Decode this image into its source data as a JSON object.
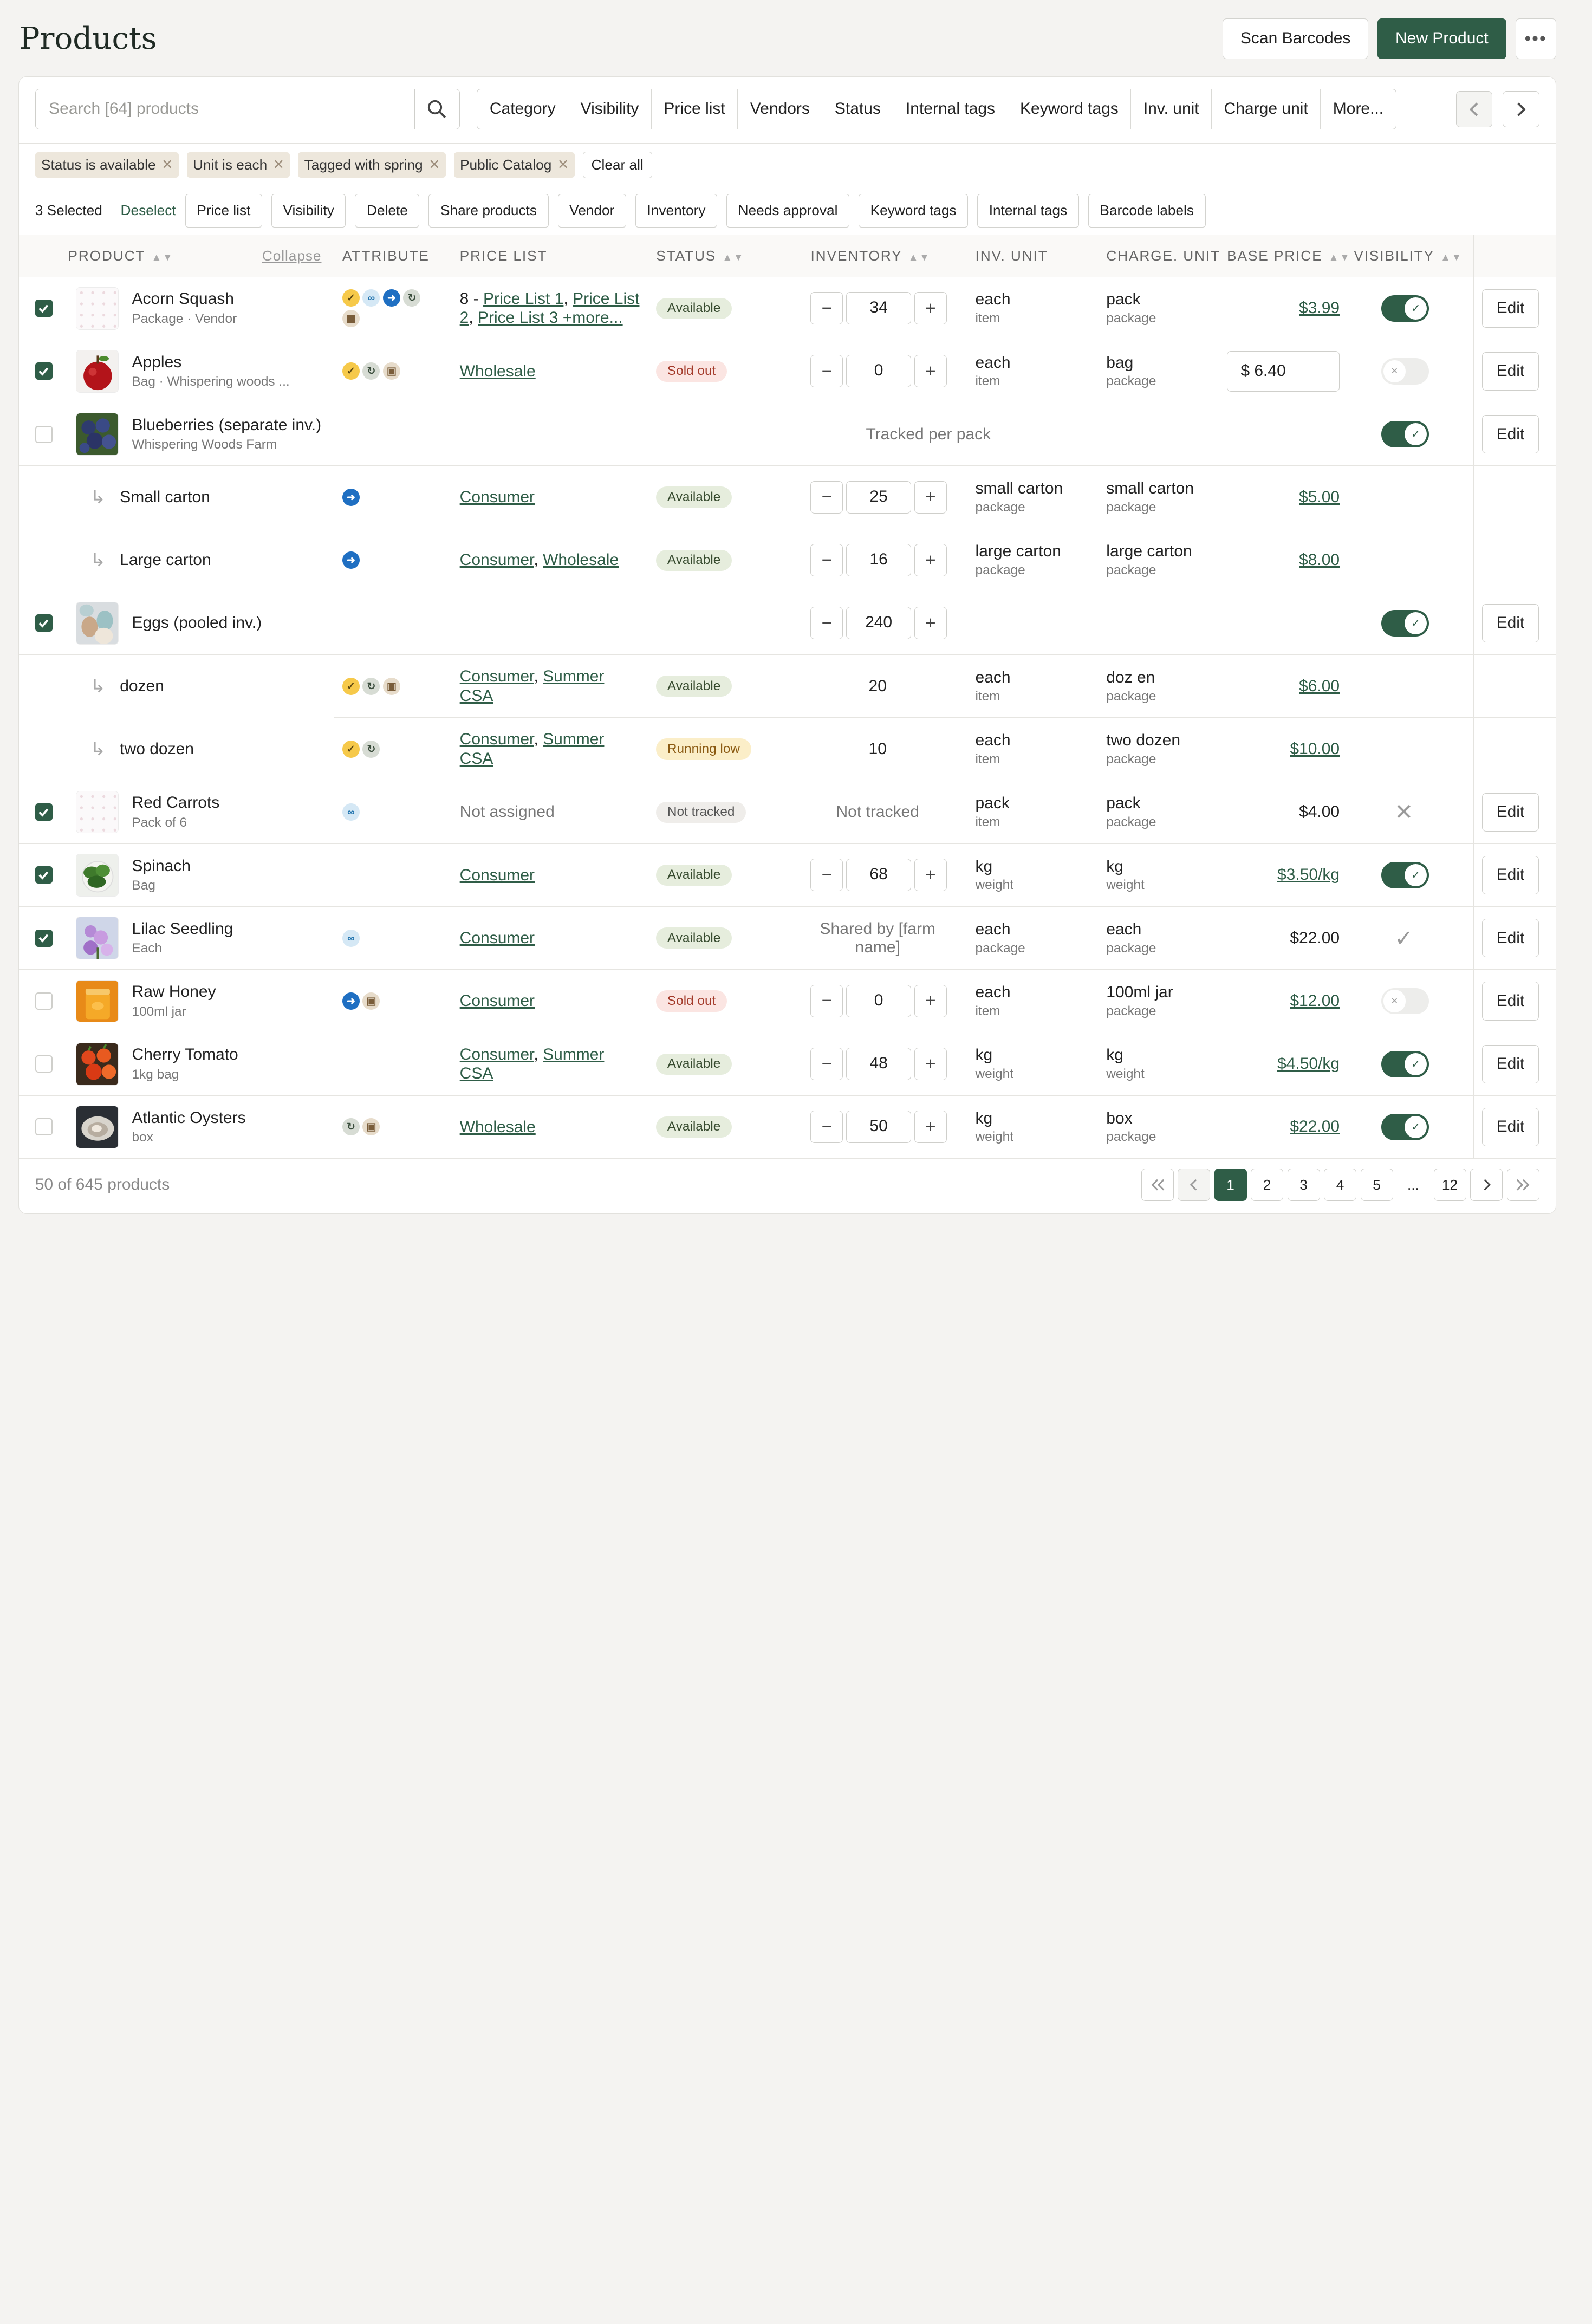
{
  "header": {
    "title": "Products",
    "scan_label": "Scan Barcodes",
    "new_label": "New Product",
    "more_label": "•••"
  },
  "search": {
    "placeholder": "Search [64] products"
  },
  "filters": [
    "Category",
    "Visibility",
    "Price list",
    "Vendors",
    "Status",
    "Internal tags",
    "Keyword tags",
    "Inv. unit",
    "Charge unit",
    "More..."
  ],
  "active_filters": [
    "Status is available",
    "Unit is each",
    "Tagged with spring",
    "Public Catalog"
  ],
  "clear_all": "Clear all",
  "bulk": {
    "selected": "3 Selected",
    "deselect": "Deselect",
    "actions": [
      "Price list",
      "Visibility",
      "Delete",
      "Share products",
      "Vendor",
      "Inventory",
      "Needs approval",
      "Keyword tags",
      "Internal tags",
      "Barcode labels"
    ]
  },
  "columns": {
    "product": "PRODUCT",
    "collapse": "Collapse",
    "attribute": "ATTRIBUTE",
    "price_list": "PRICE LIST",
    "status": "STATUS",
    "inventory": "INVENTORY",
    "inv_unit": "INV. UNIT",
    "charge_unit": "CHARGE. UNIT",
    "base_price": "BASE PRICE",
    "visibility": "VISIBILITY"
  },
  "edit_label": "Edit",
  "rows": [
    {
      "name": "Acorn Squash",
      "sub": "Package · Vendor",
      "checked": true,
      "thumb": "placeholder",
      "icons": [
        "check",
        "link",
        "go",
        "sync",
        "box"
      ],
      "price_list": [
        {
          "t": "8 - ",
          "u": false
        },
        {
          "t": "Price List 1",
          "u": true
        },
        {
          "t": ", ",
          "u": false
        },
        {
          "t": "Price List 2",
          "u": true
        },
        {
          "t": ", ",
          "u": false
        },
        {
          "t": "Price List 3 +more...",
          "u": true
        }
      ],
      "status": "Available",
      "status_kind": "avail",
      "inventory": "34",
      "inv_mode": "stepper",
      "inv_unit": "each",
      "inv_unit_sub": "item",
      "charge_unit": "pack",
      "charge_unit_sub": "package",
      "price": "$3.99",
      "price_mode": "link",
      "visibility": "on",
      "edit": true
    },
    {
      "name": "Apples",
      "sub": "Bag · Whispering woods ...",
      "checked": true,
      "thumb": "apple",
      "icons": [
        "check",
        "sync",
        "box"
      ],
      "price_list": [
        {
          "t": "Wholesale",
          "u": true
        }
      ],
      "status": "Sold out",
      "status_kind": "sold",
      "inventory": "0",
      "inv_mode": "stepper",
      "inv_unit": "each",
      "inv_unit_sub": "item",
      "charge_unit": "bag",
      "charge_unit_sub": "package",
      "price": "$ 6.40",
      "price_mode": "input",
      "visibility": "off",
      "edit": true
    },
    {
      "name": "Blueberries (separate inv.)",
      "sub": "Whispering Woods Farm",
      "checked": false,
      "thumb": "blueberry",
      "group_note": "Tracked per pack",
      "visibility": "on",
      "edit": true,
      "type": "group"
    },
    {
      "name": "Small carton",
      "type": "sub",
      "icons": [
        "go"
      ],
      "price_list": [
        {
          "t": "Consumer",
          "u": true
        }
      ],
      "status": "Available",
      "status_kind": "avail",
      "inventory": "25",
      "inv_mode": "stepper",
      "inv_unit": "small carton",
      "inv_unit_sub": "package",
      "charge_unit": "small carton",
      "charge_unit_sub": "package",
      "price": "$5.00",
      "price_mode": "link"
    },
    {
      "name": "Large carton",
      "type": "sub",
      "icons": [
        "go"
      ],
      "price_list": [
        {
          "t": "Consumer",
          "u": true
        },
        {
          "t": ", ",
          "u": false
        },
        {
          "t": "Wholesale",
          "u": true
        }
      ],
      "status": "Available",
      "status_kind": "avail",
      "inventory": "16",
      "inv_mode": "stepper",
      "inv_unit": "large carton",
      "inv_unit_sub": "package",
      "charge_unit": "large carton",
      "charge_unit_sub": "package",
      "price": "$8.00",
      "price_mode": "link"
    },
    {
      "name": "Eggs (pooled inv.)",
      "checked": true,
      "thumb": "eggs",
      "type": "pooled",
      "inventory": "240",
      "visibility": "on",
      "edit": true
    },
    {
      "name": "dozen",
      "type": "sub",
      "icons": [
        "check",
        "sync",
        "box"
      ],
      "price_list": [
        {
          "t": "Consumer",
          "u": true
        },
        {
          "t": ", ",
          "u": false
        },
        {
          "t": "Summer CSA",
          "u": true
        }
      ],
      "status": "Available",
      "status_kind": "avail",
      "inventory": "20",
      "inv_mode": "text",
      "inv_unit": "each",
      "inv_unit_sub": "item",
      "charge_unit": "doz en",
      "charge_unit_sub": "package",
      "price": "$6.00",
      "price_mode": "link"
    },
    {
      "name": "two dozen",
      "type": "sub",
      "icons": [
        "check",
        "sync"
      ],
      "price_list": [
        {
          "t": "Consumer",
          "u": true
        },
        {
          "t": ", ",
          "u": false
        },
        {
          "t": "Summer CSA",
          "u": true
        }
      ],
      "status": "Running low",
      "status_kind": "low",
      "inventory": "10",
      "inv_mode": "text",
      "inv_unit": "each",
      "inv_unit_sub": "item",
      "charge_unit": "two dozen",
      "charge_unit_sub": "package",
      "price": "$10.00",
      "price_mode": "link"
    },
    {
      "name": "Red Carrots",
      "sub": "Pack of 6",
      "checked": true,
      "thumb": "placeholder",
      "icons": [
        "link"
      ],
      "price_list": [
        {
          "t": "Not assigned",
          "u": false,
          "m": true
        }
      ],
      "status": "Not tracked",
      "status_kind": "not",
      "inventory": "Not tracked",
      "inv_mode": "mutedtext",
      "inv_unit": "pack",
      "inv_unit_sub": "item",
      "charge_unit": "pack",
      "charge_unit_sub": "package",
      "price": "$4.00",
      "price_mode": "plain",
      "visibility": "x",
      "edit": true
    },
    {
      "name": "Spinach",
      "sub": "Bag",
      "checked": true,
      "thumb": "spinach",
      "icons": [],
      "price_list": [
        {
          "t": "Consumer",
          "u": true
        }
      ],
      "status": "Available",
      "status_kind": "avail",
      "inventory": "68",
      "inv_mode": "stepper",
      "inv_unit": "kg",
      "inv_unit_sub": "weight",
      "charge_unit": "kg",
      "charge_unit_sub": "weight",
      "price": "$3.50/kg",
      "price_mode": "link",
      "visibility": "on",
      "edit": true
    },
    {
      "name": "Lilac Seedling",
      "sub": "Each",
      "checked": true,
      "thumb": "lilac",
      "icons": [
        "link"
      ],
      "price_list": [
        {
          "t": "Consumer",
          "u": true
        }
      ],
      "status": "Available",
      "status_kind": "avail",
      "inventory": "Shared by [farm name]",
      "inv_mode": "mutedtext",
      "inv_unit": "each",
      "inv_unit_sub": "package",
      "charge_unit": "each",
      "charge_unit_sub": "package",
      "price": "$22.00",
      "price_mode": "plain",
      "visibility": "check",
      "edit": true
    },
    {
      "name": "Raw Honey",
      "sub": "100ml jar",
      "checked": false,
      "thumb": "honey",
      "icons": [
        "go",
        "box"
      ],
      "price_list": [
        {
          "t": "Consumer",
          "u": true
        }
      ],
      "status": "Sold out",
      "status_kind": "sold",
      "inventory": "0",
      "inv_mode": "stepper",
      "inv_unit": "each",
      "inv_unit_sub": "item",
      "charge_unit": "100ml jar",
      "charge_unit_sub": "package",
      "price": "$12.00",
      "price_mode": "link",
      "visibility": "off",
      "edit": true
    },
    {
      "name": "Cherry Tomato",
      "sub": "1kg bag",
      "checked": false,
      "thumb": "tomato",
      "icons": [],
      "price_list": [
        {
          "t": "Consumer",
          "u": true
        },
        {
          "t": ", ",
          "u": false
        },
        {
          "t": "Summer CSA",
          "u": true
        }
      ],
      "status": "Available",
      "status_kind": "avail",
      "inventory": "48",
      "inv_mode": "stepper",
      "inv_unit": "kg",
      "inv_unit_sub": "weight",
      "charge_unit": "kg",
      "charge_unit_sub": "weight",
      "price": "$4.50/kg",
      "price_mode": "link",
      "visibility": "on",
      "edit": true
    },
    {
      "name": "Atlantic Oysters",
      "sub": "box",
      "checked": false,
      "thumb": "oyster",
      "icons": [
        "sync",
        "box"
      ],
      "price_list": [
        {
          "t": "Wholesale",
          "u": true
        }
      ],
      "status": "Available",
      "status_kind": "avail",
      "inventory": "50",
      "inv_mode": "stepper",
      "inv_unit": "kg",
      "inv_unit_sub": "weight",
      "charge_unit": "box",
      "charge_unit_sub": "package",
      "price": "$22.00",
      "price_mode": "link",
      "visibility": "on",
      "edit": true
    }
  ],
  "footer": {
    "count": "50 of 645 products",
    "pages": [
      "1",
      "2",
      "3",
      "4",
      "5",
      "...",
      "12"
    ],
    "current": "1"
  },
  "colors": {
    "accent": "#2f5d47",
    "available": "#e6eddd",
    "sold_out": "#fbe5e2",
    "running_low": "#fbeec8"
  }
}
